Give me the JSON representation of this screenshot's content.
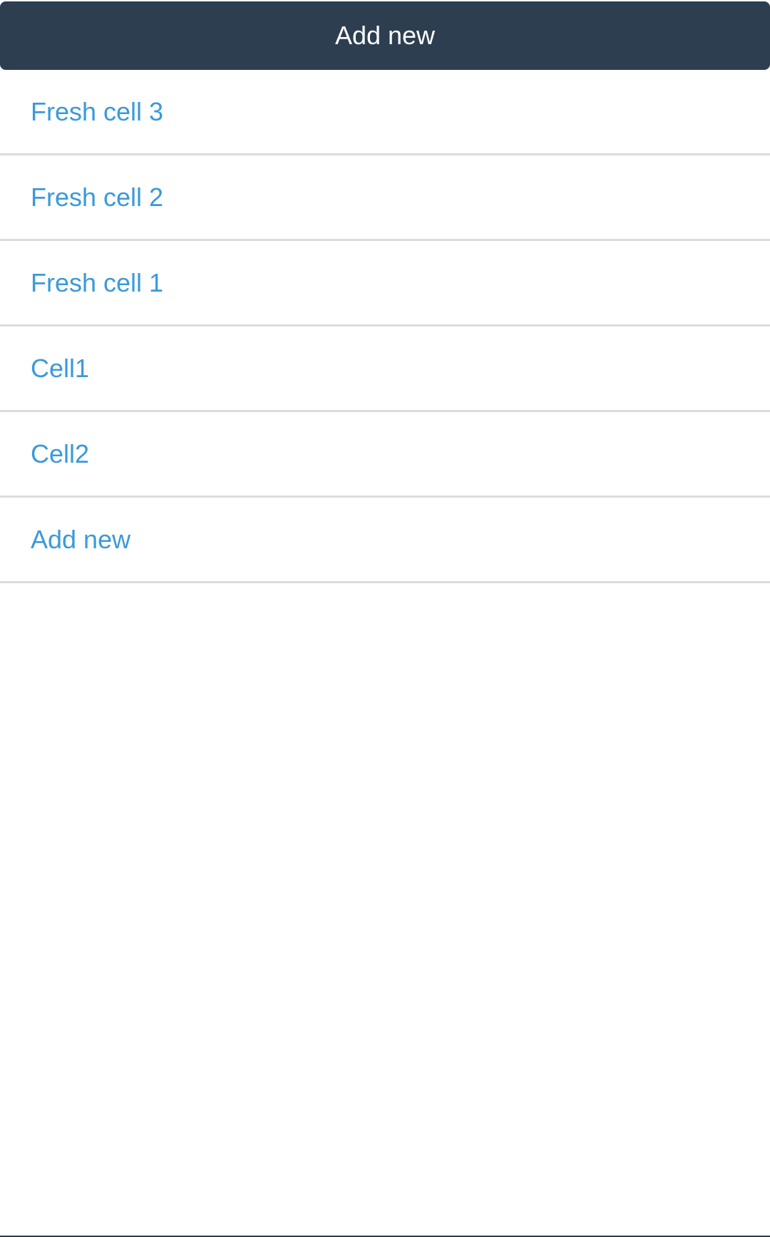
{
  "header": {
    "button_label": "Add new"
  },
  "list": {
    "items": [
      {
        "label": "Fresh cell 3"
      },
      {
        "label": "Fresh cell 2"
      },
      {
        "label": "Fresh cell 1"
      },
      {
        "label": "Cell1"
      },
      {
        "label": "Cell2"
      },
      {
        "label": "Add new"
      }
    ]
  },
  "colors": {
    "header_background": "#2c3e50",
    "header_text": "#ffffff",
    "item_text": "#3a9ad9",
    "divider": "#dcdcdc"
  }
}
